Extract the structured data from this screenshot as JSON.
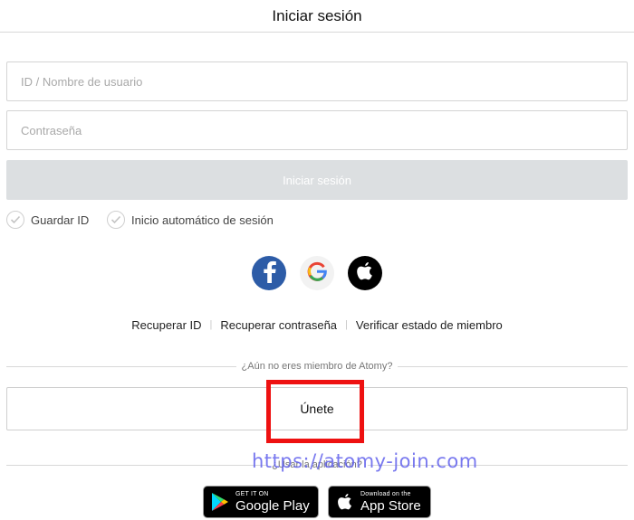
{
  "header": {
    "title": "Iniciar sesión"
  },
  "form": {
    "id_placeholder": "ID / Nombre de usuario",
    "password_placeholder": "Contraseña",
    "login_label": "Iniciar sesión",
    "save_id_label": "Guardar ID",
    "auto_login_label": "Inicio automático de sesión"
  },
  "social": {
    "icons": [
      "facebook-icon",
      "google-icon",
      "apple-icon"
    ]
  },
  "links": {
    "recover_id": "Recuperar ID",
    "recover_password": "Recuperar contraseña",
    "verify_status": "Verificar estado de miembro"
  },
  "membership": {
    "prompt": "¿Aún no eres miembro de Atomy?",
    "join_label": "Únete"
  },
  "apps": {
    "prompt": "¿Usar la aplicación?",
    "google_play": {
      "small": "GET IT ON",
      "big": "Google Play"
    },
    "app_store": {
      "small": "Download on the",
      "big": "App Store"
    }
  },
  "watermark": "https://atomy-join.com",
  "colors": {
    "facebook": "#2d5ca7",
    "login_button_disabled": "#dcdfe1",
    "highlight": "#ee1111",
    "watermark": "#5c5ceb"
  }
}
